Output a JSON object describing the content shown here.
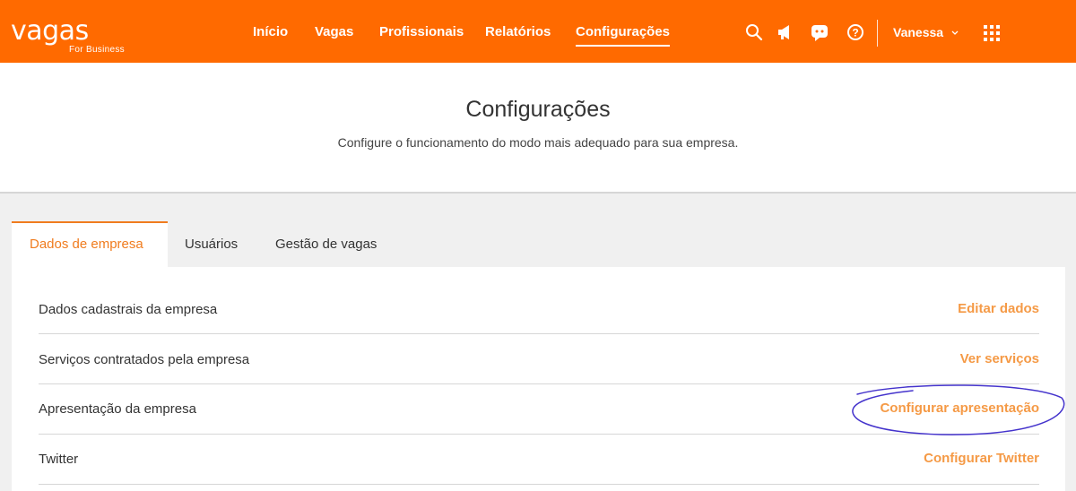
{
  "brand": {
    "name": "vagas",
    "tagline": "For Business",
    "color": "#ff6a00",
    "accent": "#f07c1f"
  },
  "nav": {
    "items": [
      {
        "label": "Início"
      },
      {
        "label": "Vagas"
      },
      {
        "label": "Profissionais"
      },
      {
        "label": "Relatórios"
      },
      {
        "label": "Configurações",
        "active": true
      }
    ],
    "icons": [
      "search-icon",
      "megaphone-icon",
      "chat-icon",
      "help-icon",
      "apps-grid-icon"
    ],
    "user": "Vanessa"
  },
  "header": {
    "title": "Configurações",
    "subtitle": "Configure o funcionamento do modo mais adequado para sua empresa."
  },
  "tabs": [
    {
      "label": "Dados de empresa",
      "active": true
    },
    {
      "label": "Usuários"
    },
    {
      "label": "Gestão de vagas"
    }
  ],
  "rows": [
    {
      "label": "Dados cadastrais da empresa",
      "action": "Editar dados"
    },
    {
      "label": "Serviços contratados pela empresa",
      "action": "Ver serviços"
    },
    {
      "label": "Apresentação da empresa",
      "action": "Configurar apresentação",
      "highlighted": true
    },
    {
      "label": "Twitter",
      "action": "Configurar Twitter"
    }
  ],
  "annotation_color": "#4433cc"
}
